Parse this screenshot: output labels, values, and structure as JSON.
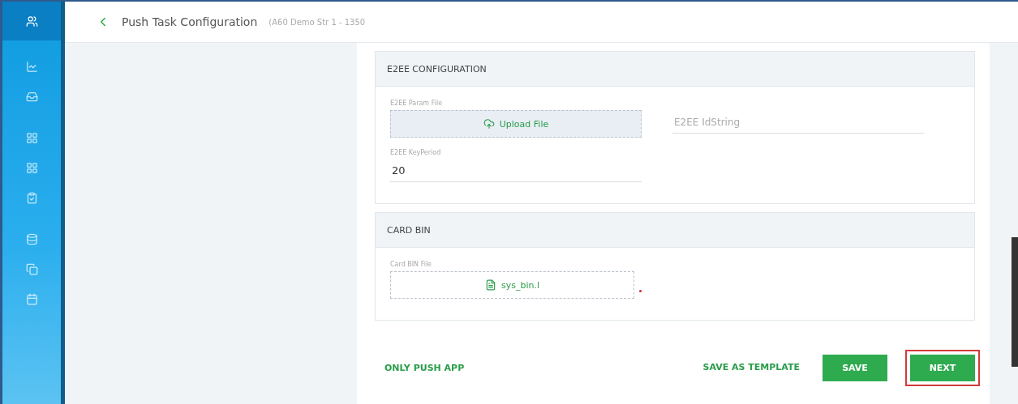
{
  "sidebar": {
    "items": [
      {
        "selected": true
      },
      {
        "selected": false
      },
      {
        "selected": false
      },
      {
        "selected": false
      },
      {
        "selected": false
      },
      {
        "selected": false
      },
      {
        "selected": false
      },
      {
        "selected": false
      },
      {
        "selected": false
      }
    ]
  },
  "header": {
    "title": "Push Task Configuration",
    "subtitle": "(A60 Demo Str 1 - 1350"
  },
  "sections": [
    {
      "title": "E2EE CONFIGURATION",
      "fields": [
        {
          "kind": "upload",
          "label": "E2EE Param File",
          "text": "Upload File"
        },
        {
          "kind": "input",
          "placeholder": "E2EE IdString"
        },
        {
          "kind": "input",
          "label": "E2EE KeyPeriod",
          "value": "20"
        }
      ]
    },
    {
      "title": "CARD BIN",
      "fields": [
        {
          "kind": "file",
          "label": "Card BIN File",
          "text": "sys_bin.l",
          "required": true
        }
      ]
    }
  ],
  "footer": {
    "link": "ONLY PUSH APP",
    "buttons": [
      {
        "kind": "text",
        "label": "SAVE AS TEMPLATE",
        "highlighted": false
      },
      {
        "kind": "solid",
        "label": "SAVE",
        "highlighted": false
      },
      {
        "kind": "solid",
        "label": "NEXT",
        "highlighted": true
      }
    ]
  }
}
